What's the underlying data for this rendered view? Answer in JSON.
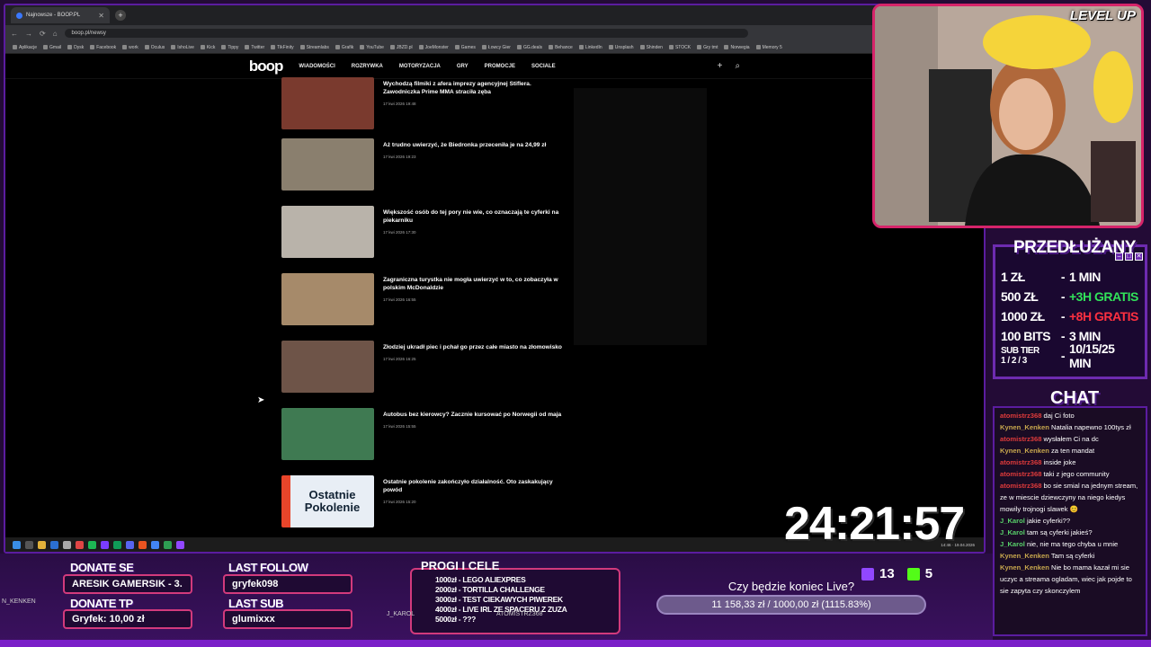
{
  "browser": {
    "tab_title": "Najnowsze - BOOP.PL",
    "url": "boop.pl/newsy",
    "bookmarks": [
      "Aplikacje",
      "Gmail",
      "Dysk",
      "Facebook",
      "work",
      "Oculus",
      "IshoLive",
      "Kick",
      "Tippy",
      "Twitter",
      "TikFinity",
      "Streamlabs",
      "Grafik",
      "YouTube",
      "JBZD.pl",
      "JoeMonster",
      "Games",
      "Łowcy Gier",
      "GG.deals",
      "Behance",
      "LinkedIn",
      "Unsplash",
      "Shinden",
      "STOCK",
      "Gry tmt",
      "Norwegia",
      "Memory 5"
    ]
  },
  "site": {
    "logo": "boop",
    "nav": [
      "WIADOMOŚCI",
      "ROZRYWKA",
      "MOTORYZACJA",
      "GRY",
      "PROMOCJE",
      "SOCIALE"
    ],
    "articles": [
      {
        "title": "Wychodzą filmiki z afera imprezy agencyjnej Stiflera. Zawodniczka Prime MMA straciła zęba",
        "date": "17 kwi 2026 19:48",
        "color": "#7a3a2e"
      },
      {
        "title": "Aż trudno uwierzyć, że Biedronka przeceniła je na 24,99 zł",
        "date": "17 kwi 2026 19:23",
        "color": "#8a7f6e"
      },
      {
        "title": "Większość osób do tej pory nie wie, co oznaczają te cyferki na piekarniku",
        "date": "17 kwi 2026 17:30",
        "color": "#b9b3aa"
      },
      {
        "title": "Zagraniczna turystka nie mogła uwierzyć w to, co zobaczyła w polskim McDonaldzie",
        "date": "17 kwi 2026 16:55",
        "color": "#a68a6a"
      },
      {
        "title": "Złodziej ukradł piec i pchał go przez całe miasto na złomowisko",
        "date": "17 kwi 2026 16:25",
        "color": "#6e5448"
      },
      {
        "title": "Autobus bez kierowcy? Zacznie kursować po Norwegii od maja",
        "date": "17 kwi 2026 15:55",
        "color": "#3f7a52"
      },
      {
        "title": "Ostatnie pokolenie zakończyło działalność. Oto zaskakujący powód",
        "date": "17 kwi 2026 15:20",
        "color": "#e8eef5"
      }
    ],
    "thumb_text_last": "Ostatnie Pokolenie",
    "taskbar_time": "14:46",
    "taskbar_date": "19.04.2026",
    "taskbar_notice": "Złote zachmurze..."
  },
  "overlay": {
    "levelup": "LEVEL UP",
    "przedluzany_title": "PRZEDŁUŻANY",
    "rows": [
      {
        "left": "1 ZŁ",
        "right": "1 MIN",
        "color": "white"
      },
      {
        "left": "500 ZŁ",
        "right": "+3H GRATIS",
        "color": "green"
      },
      {
        "left": "1000 ZŁ",
        "right": "+8H GRATIS",
        "color": "red"
      },
      {
        "left": "100 BITS",
        "right": "3 MIN",
        "color": "white"
      },
      {
        "left": "SUB TIER",
        "left2": "1 / 2 / 3",
        "right": "10/15/25 MIN",
        "color": "white"
      }
    ],
    "chat_title": "CHAT",
    "chat": [
      {
        "user": "atomistrz368",
        "text": "daj Ci foto",
        "cls": "u1"
      },
      {
        "user": "Kynen_Kenken",
        "text": "Natalia napewno 100tys zł",
        "cls": "u2"
      },
      {
        "user": "atomistrz368",
        "text": "wysłałem Ci na dc",
        "cls": "u1"
      },
      {
        "user": "Kynen_Kenken",
        "text": "za ten mandat",
        "cls": "u2"
      },
      {
        "user": "atomistrz368",
        "text": "inside joke",
        "cls": "u1"
      },
      {
        "user": "atomistrz368",
        "text": "taki z jego community",
        "cls": "u1"
      },
      {
        "user": "atomistrz368",
        "text": "bo sie smial na jednym stream, ze w miescie dziewczyny na niego kiedys mowily trojnogi slawek 😊",
        "cls": "u1"
      },
      {
        "user": "J_Karol",
        "text": "jakie cyferki??",
        "cls": "u3"
      },
      {
        "user": "J_Karol",
        "text": "tam są cyferki jakieś?",
        "cls": "u3"
      },
      {
        "user": "J_Karol",
        "text": "nie, nie ma tego chyba u mnie",
        "cls": "u3"
      },
      {
        "user": "Kynen_Kenken",
        "text": "Tam są cyferki",
        "cls": "u2"
      },
      {
        "user": "Kynen_Kenken",
        "text": "Nie bo mama kazał mi sie uczyc a streama ogladam, wiec jak pojde to sie zapyta czy skonczylem",
        "cls": "u2"
      }
    ],
    "timer": "24:21:57",
    "donate_se_label": "DONATE SE",
    "donate_se_value": "ARESIK GAMERSIK - 3.",
    "donate_tp_label": "DONATE TP",
    "donate_tp_value": "Gryfek: 10,00 zł",
    "last_follow_label": "LAST FOLLOW",
    "last_follow_value": "gryfek098",
    "last_sub_label": "LAST SUB",
    "last_sub_value": "glumixxx",
    "progi_title": "PROGI I CELE",
    "progi": [
      "1000zł - LEGO ALIEXPRES",
      "2000zł - TORTILLA CHALLENGE",
      "3000zł - TEST CIEKAWYCH PIWEREK",
      "4000zł - LIVE IRL ZE SPACERU Z ZUZA",
      "5000zł - ???"
    ],
    "koniec_title": "Czy będzie koniec Live?",
    "goal": "11 158,33 zł / 1000,00 zł (1115.83%)",
    "viewers": "13",
    "kick_count": "5",
    "tag1": "J_KAROL",
    "tag2": "ATOMISTRZ368",
    "tag3": "N_KENKEN"
  }
}
